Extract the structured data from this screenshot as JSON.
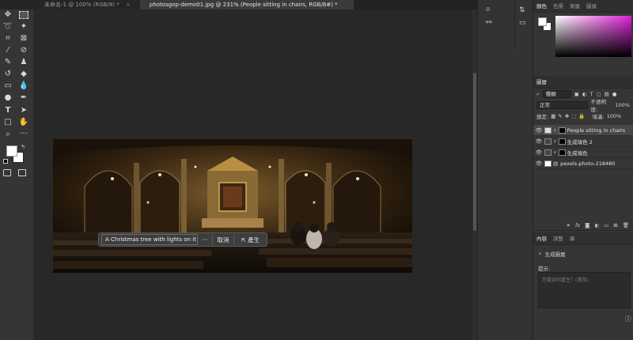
{
  "tabs": [
    {
      "label": "未命名-1 @ 100% (RGB/8) *"
    },
    {
      "label": "photosgop-demo01.jpg @ 231% (People sitting in chairs, RGB/8#) *"
    }
  ],
  "gen_bar": {
    "prompt": "A Christmas tree with lights on it",
    "more": "···",
    "cancel": "取消",
    "generate": "產生"
  },
  "color_panel": {
    "tabs": [
      "顏色",
      "色票",
      "漸層",
      "圖樣"
    ]
  },
  "layers_panel": {
    "title": "圖層",
    "filter": "種類",
    "blend_mode": "正常",
    "opacity_label": "不透明度:",
    "opacity_value": "100%",
    "lock_label": "鎖定:",
    "fill_label": "填滿:",
    "fill_value": "100%",
    "layers": [
      {
        "name": "People sitting in chairs"
      },
      {
        "name": "生成填色 2"
      },
      {
        "name": "生成填色"
      },
      {
        "name": "pexels-photo-218480"
      }
    ]
  },
  "properties_panel": {
    "tabs": [
      "內容",
      "調整",
      "庫"
    ],
    "layer_type": "生成圖層",
    "prompt_label": "提示:",
    "prompt_placeholder": "您要如何產生？(選用)"
  }
}
